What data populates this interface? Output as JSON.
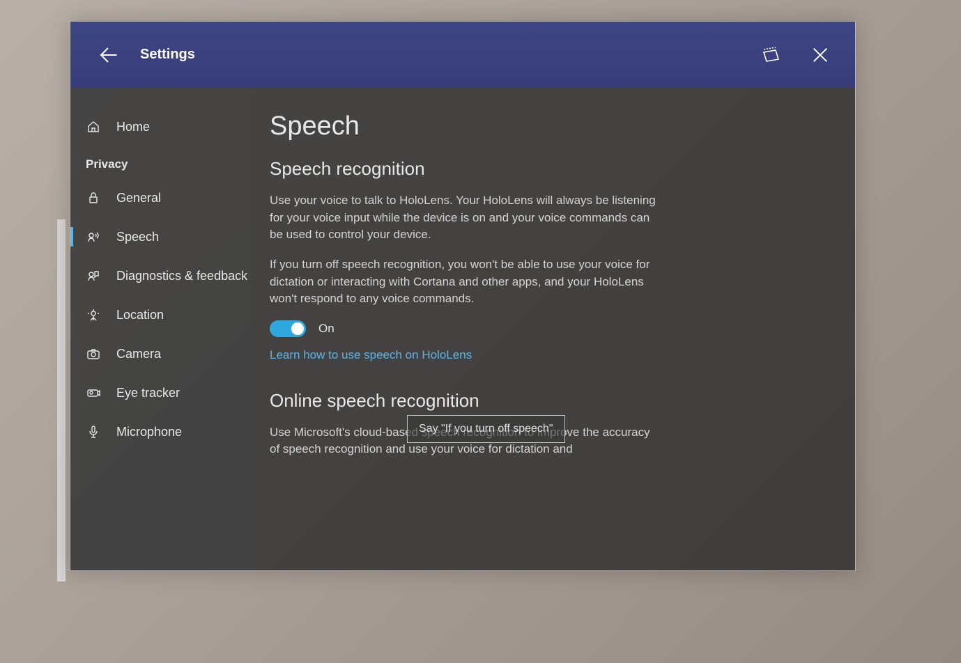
{
  "titlebar": {
    "title": "Settings"
  },
  "sidebar": {
    "home_label": "Home",
    "section_label": "Privacy",
    "items": [
      {
        "key": "general",
        "label": "General",
        "selected": false
      },
      {
        "key": "speech",
        "label": "Speech",
        "selected": true
      },
      {
        "key": "diagnostics",
        "label": "Diagnostics & feedback",
        "selected": false
      },
      {
        "key": "location",
        "label": "Location",
        "selected": false
      },
      {
        "key": "camera",
        "label": "Camera",
        "selected": false
      },
      {
        "key": "eyetracker",
        "label": "Eye tracker",
        "selected": false
      },
      {
        "key": "microphone",
        "label": "Microphone",
        "selected": false
      }
    ]
  },
  "main": {
    "page_title": "Speech",
    "section1_title": "Speech recognition",
    "section1_para1": "Use your voice to talk to HoloLens. Your HoloLens will always be listening for your voice input while the device is on and your voice commands can be used to control your device.",
    "section1_para2": "If you turn off speech recognition, you won't be able to use your voice for dictation or interacting with Cortana and other apps, and your HoloLens won't respond to any voice commands.",
    "toggle_state": "On",
    "toggle_on": true,
    "link_text": "Learn how to use speech on HoloLens",
    "section2_title": "Online speech recognition",
    "section2_para1": "Use Microsoft's cloud-based speech recognition to improve the accuracy of speech recognition and use your voice for dictation and"
  },
  "tooltip": {
    "text": "Say \"If you turn off speech\""
  },
  "colors": {
    "accent": "#5fb3e7",
    "titlebar": "#3b4180",
    "toggle_on": "#2ea8df"
  }
}
